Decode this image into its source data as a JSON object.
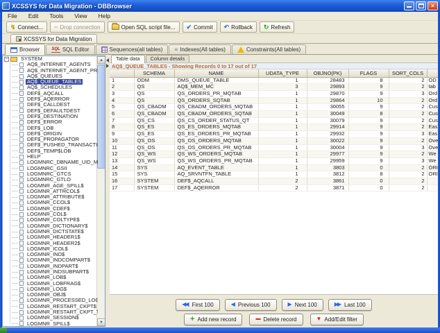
{
  "window": {
    "title": "XCSSYS for Data Migration - DBBrowser"
  },
  "menubar": {
    "items": [
      "File",
      "Edit",
      "Tools",
      "View",
      "Help"
    ]
  },
  "toolbar": {
    "buttons": [
      {
        "label": "Connect...",
        "icon": "connect-icon",
        "disabled": false
      },
      {
        "label": "Drop connection",
        "icon": "drop-connection-icon",
        "disabled": true
      },
      {
        "label": "Open SQL script file...",
        "icon": "open-file-icon",
        "disabled": false
      },
      {
        "label": "Commit",
        "icon": "commit-icon",
        "disabled": false
      },
      {
        "label": "Rollback",
        "icon": "rollback-icon",
        "disabled": false
      },
      {
        "label": "Refresh",
        "icon": "refresh-icon",
        "disabled": false
      }
    ]
  },
  "session_tab": {
    "label": "XCSSYS for Data Migration"
  },
  "main_tabs": [
    {
      "label": "Browser",
      "icon": "browser-icon",
      "selected": true
    },
    {
      "label": "SQL Editor",
      "icon": "sql-icon",
      "selected": false
    },
    {
      "label": "Sequences(all tables)",
      "icon": "sequences-icon",
      "selected": false
    },
    {
      "label": "Indexes(All tables)",
      "icon": "indexes-icon",
      "selected": false
    },
    {
      "label": "Constraints(All tables)",
      "icon": "constraints-icon",
      "selected": false
    }
  ],
  "tree": {
    "root": "SYSTEM",
    "selected": "AQ$_QUEUE_TABLES",
    "items": [
      "AQ$_INTERNET_AGENTS",
      "AQ$_INTERNET_AGENT_PRIVS",
      "AQ$_QUEUES",
      "AQ$_QUEUE_TABLES",
      "AQ$_SCHEDULES",
      "DEF$_AQCALL",
      "DEF$_AQERROR",
      "DEF$_CALLDEST",
      "DEF$_DEFAULTDEST",
      "DEF$_DESTINATION",
      "DEF$_ERROR",
      "DEF$_LOB",
      "DEF$_ORIGIN",
      "DEF$_PROPAGATOR",
      "DEF$_PUSHED_TRANSACTIONS",
      "DEF$_TEMP$LOB",
      "HELP",
      "LOGMNRC_DBNAME_UID_MAP",
      "LOGMNRC_GSII",
      "LOGMNRC_GTCS",
      "LOGMNRC_GTLO",
      "LOGMNR_AGE_SPILL$",
      "LOGMNR_ATTRCOL$",
      "LOGMNR_ATTRIBUTE$",
      "LOGMNR_CCOL$",
      "LOGMNR_CDEF$",
      "LOGMNR_COL$",
      "LOGMNR_COLTYPE$",
      "LOGMNR_DICTIONARY$",
      "LOGMNR_DICTSTATE$",
      "LOGMNR_HEADER1$",
      "LOGMNR_HEADER2$",
      "LOGMNR_ICOL$",
      "LOGMNR_IND$",
      "LOGMNR_INDCOMPART$",
      "LOGMNR_INDPART$",
      "LOGMNR_INDSUBPART$",
      "LOGMNR_LOB$",
      "LOGMNR_LOBFRAG$",
      "LOGMNR_LOG$",
      "LOGMNR_OBJ$",
      "LOGMNR_PROCESSED_LOG$",
      "LOGMNR_RESTART_CKPT$",
      "LOGMNR_RESTART_CKPT_TXINFO$",
      "LOGMNR_SESSION$",
      "LOGMNR_SPILL$"
    ]
  },
  "detail": {
    "tabs": [
      {
        "label": "Table data",
        "selected": true
      },
      {
        "label": "Column details",
        "selected": false
      }
    ],
    "status": "AQ$_QUEUE_TABLES - Showing Records 0 to 17 out of 17",
    "table": {
      "columns": [
        "",
        "SCHEMA",
        "NAME",
        "UDATA_TYPE",
        "OBJNO(PK)",
        "FLAGS",
        "SORT_COLS",
        ""
      ],
      "rows": [
        [
          "1",
          "ODM",
          "DMS_QUEUE_TABLE",
          "1",
          "28483",
          "8",
          "2",
          "OD"
        ],
        [
          "2",
          "QS",
          "AQ$_MEM_MC",
          "3",
          "29893",
          "9",
          "2",
          "tab"
        ],
        [
          "3",
          "QS",
          "QS_ORDERS_PR_MQTAB",
          "1",
          "29870",
          "9",
          "3",
          "Ord"
        ],
        [
          "4",
          "QS",
          "QS_ORDERS_SQTAB",
          "1",
          "29864",
          "10",
          "2",
          "Ord"
        ],
        [
          "5",
          "QS_CBADM",
          "QS_CBADM_ORDERS_MQTAB",
          "1",
          "30055",
          "9",
          "2",
          "Cus"
        ],
        [
          "6",
          "QS_CBADM",
          "QS_CBADM_ORDERS_SQTAB",
          "1",
          "30049",
          "8",
          "2",
          "Cus"
        ],
        [
          "7",
          "QS_CS",
          "QS_CS_ORDER_STATUS_QT",
          "1",
          "30079",
          "9",
          "2",
          "Cus"
        ],
        [
          "8",
          "QS_ES",
          "QS_ES_ORDERS_MQTAB",
          "1",
          "29914",
          "9",
          "2",
          "Eas"
        ],
        [
          "9",
          "QS_ES",
          "QS_ES_ORDERS_PR_MQTAB",
          "1",
          "29932",
          "9",
          "3",
          "Eas"
        ],
        [
          "10",
          "QS_OS",
          "QS_OS_ORDERS_MQTAB",
          "1",
          "30022",
          "9",
          "2",
          "Ove"
        ],
        [
          "11",
          "QS_OS",
          "QS_OS_ORDERS_PR_MQTAB",
          "1",
          "30004",
          "9",
          "3",
          "Ove"
        ],
        [
          "12",
          "QS_WS",
          "QS_WS_ORDERS_MQTAB",
          "1",
          "29977",
          "9",
          "2",
          "We"
        ],
        [
          "13",
          "QS_WS",
          "QS_WS_ORDERS_PR_MQTAB",
          "1",
          "29959",
          "9",
          "3",
          "We"
        ],
        [
          "14",
          "SYS",
          "AQ_EVENT_TABLE",
          "1",
          "3803",
          "0",
          "2",
          "ORI"
        ],
        [
          "15",
          "SYS",
          "AQ_SRVNTFN_TABLE",
          "1",
          "3812",
          "8",
          "2",
          "ORI"
        ],
        [
          "16",
          "SYSTEM",
          "DEF$_AQCALL",
          "2",
          "3861",
          "0",
          "2",
          ""
        ],
        [
          "17",
          "SYSTEM",
          "DEF$_AQERROR",
          "2",
          "3871",
          "0",
          "2",
          ""
        ]
      ]
    },
    "nav_buttons": [
      {
        "label": "First 100",
        "icon": "first-icon"
      },
      {
        "label": "Previous 100",
        "icon": "previous-icon"
      },
      {
        "label": "Next 100",
        "icon": "next-icon"
      },
      {
        "label": "Last 100",
        "icon": "last-icon"
      }
    ],
    "record_buttons": [
      {
        "label": "Add new record",
        "icon": "add-icon"
      },
      {
        "label": "Delete record",
        "icon": "delete-icon"
      },
      {
        "label": "Add/Edit filter",
        "icon": "filter-icon"
      }
    ]
  },
  "colors": {
    "titlebar_blue": "#1E5CD8",
    "selection_navy": "#35479D",
    "status_text_orange": "#BE6A2A",
    "taskbar_blue": "#2E64D8",
    "start_green": "#3DA63D"
  }
}
